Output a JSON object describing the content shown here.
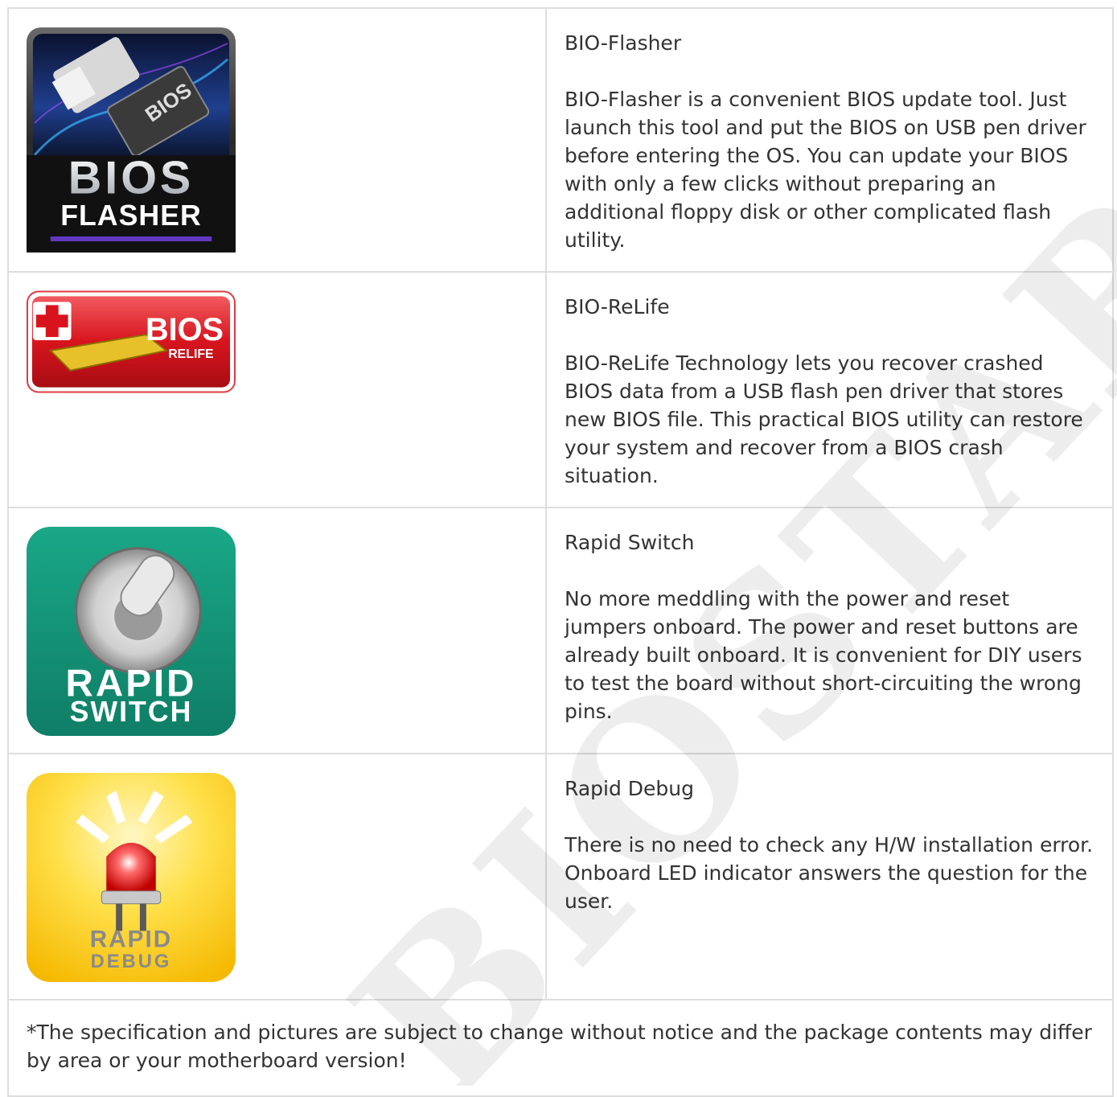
{
  "features": [
    {
      "title": "BIO-Flasher",
      "description": "BIO-Flasher is a convenient BIOS update tool. Just launch this tool and put the BIOS on USB pen driver before entering the OS. You can update your BIOS with only a few clicks without preparing an additional floppy disk or other complicated flash utility.",
      "logo": {
        "line1": "BIOS",
        "line2": "FLASHER",
        "chip_text": "BIOS",
        "icon": "usb-bios-chip-icon"
      }
    },
    {
      "title": "BIO-ReLife",
      "description": "BIO-ReLife Technology lets you recover crashed BIOS data from a USB flash pen driver that stores new BIOS file. This practical BIOS utility can restore your system and recover from a BIOS crash situation.",
      "logo": {
        "line1": "BIOS",
        "line2": "RELIFE",
        "icon": "red-cross-chip-icon"
      }
    },
    {
      "title": "Rapid Switch",
      "description": "No more meddling with the power and reset jumpers onboard. The power and reset buttons are already built onboard. It is convenient for DIY users to test the board without short-circuiting the wrong pins.",
      "logo": {
        "line1": "RAPID",
        "line2": "SWITCH",
        "icon": "toggle-switch-icon"
      }
    },
    {
      "title": "Rapid Debug",
      "description": "There is no need to check any H/W installation error. Onboard LED indicator answers the question for the user.",
      "logo": {
        "line1": "RAPID",
        "line2": "DEBUG",
        "icon": "led-indicator-icon"
      }
    }
  ],
  "footnote": "*The specification and pictures are subject to change without notice and the package contents may differ by area or your motherboard version!",
  "watermark": "BIOSTAR",
  "colors": {
    "border": "#dddddd",
    "text": "#333333",
    "relife_red": "#d7141d",
    "switch_green": "#1a9e7e",
    "debug_yellow": "#ffd200"
  }
}
